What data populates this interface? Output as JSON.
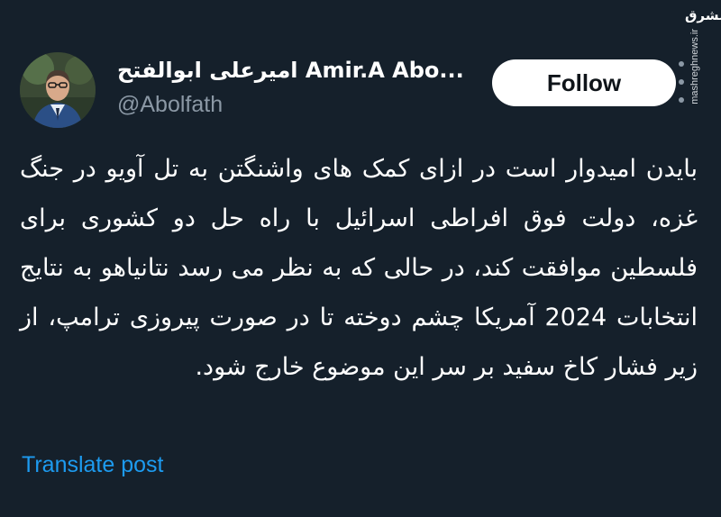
{
  "watermark": {
    "logo": "مشرق",
    "url": "mashreghnews.ir"
  },
  "profile": {
    "display_name": "امیرعلی ابوالفتح Amir.A Abo...",
    "handle": "@Abolfath",
    "follow_label": "Follow"
  },
  "tweet": {
    "text": "بایدن امیدوار است در ازای کمک های واشنگتن به تل آویو در جنگ غزه، دولت فوق افراطی اسرائیل با راه حل دو کشوری برای فلسطین موافقت کند، در حالی که به نظر می رسد نتانیاهو به نتایج انتخابات 2024 آمریکا چشم دوخته تا در صورت پیروزی ترامپ، از زیر فشار کاخ سفید بر سر این موضوع خارج شود.",
    "translate_label": "Translate post"
  },
  "colors": {
    "background": "#15202b",
    "accent_link": "#1d9bf0",
    "muted": "#8b98a5"
  }
}
